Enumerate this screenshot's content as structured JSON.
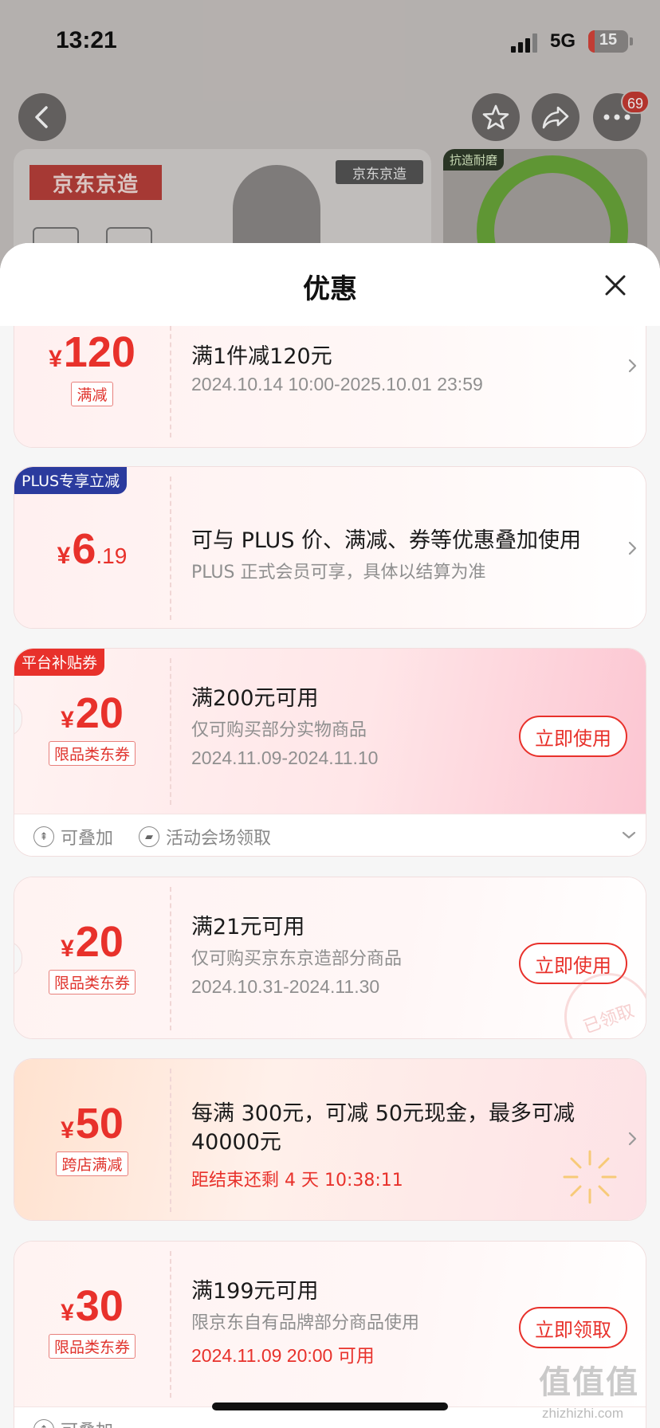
{
  "status_bar": {
    "time": "13:21",
    "network": "5G",
    "battery": "15",
    "battery_fraction": 0.15
  },
  "header_actions": {
    "cart_badge": "69"
  },
  "background": {
    "brand_logo": "京东京造",
    "brand_small": "京东京造",
    "side_tag": "抗造耐磨"
  },
  "sheet": {
    "title": "优惠"
  },
  "coupons": [
    {
      "currency": "¥",
      "amount": "120",
      "decimal": "",
      "tag": "满减",
      "title": "满1件减120元",
      "line2": "2024.10.14 10:00-2025.10.01 23:59"
    },
    {
      "corner": "PLUS专享立减",
      "currency": "¥",
      "amount": "6",
      "decimal": ".19",
      "title": "可与 PLUS 价、满减、券等优惠叠加使用",
      "line2": "PLUS 正式会员可享，具体以结算为准"
    },
    {
      "corner": "平台补贴券",
      "currency": "¥",
      "amount": "20",
      "decimal": "",
      "tag": "限品类东券",
      "title": "满200元可用",
      "line2": "仅可购买部分实物商品",
      "line3": "2024.11.09-2024.11.10",
      "button": "立即使用",
      "footer_stack": "可叠加",
      "footer_source": "活动会场领取"
    },
    {
      "currency": "¥",
      "amount": "20",
      "decimal": "",
      "tag": "限品类东券",
      "title": "满21元可用",
      "line2": "仅可购买京东京造部分商品",
      "line3": "2024.10.31-2024.11.30",
      "button": "立即使用",
      "stamp": "已领取"
    },
    {
      "currency": "¥",
      "amount": "50",
      "decimal": "",
      "tag": "跨店满减",
      "title": "每满 300元，可减 50元现金，最多可减",
      "title2": "40000元",
      "line2": "距结束还剩 4 天 10:38:11"
    },
    {
      "currency": "¥",
      "amount": "30",
      "decimal": "",
      "tag": "限品类东券",
      "title": "满199元可用",
      "line2": "限京东自有品牌部分商品使用",
      "line3": "2024.11.09 20:00 可用",
      "button": "立即领取",
      "footer_stack": "可叠加"
    }
  ],
  "watermark": {
    "main": "值值值",
    "sub": "zhizhizhi.com"
  },
  "colors": {
    "accent": "#e8312b",
    "plus_blue": "#2b3b9e",
    "platform_red": "#e8312b"
  }
}
